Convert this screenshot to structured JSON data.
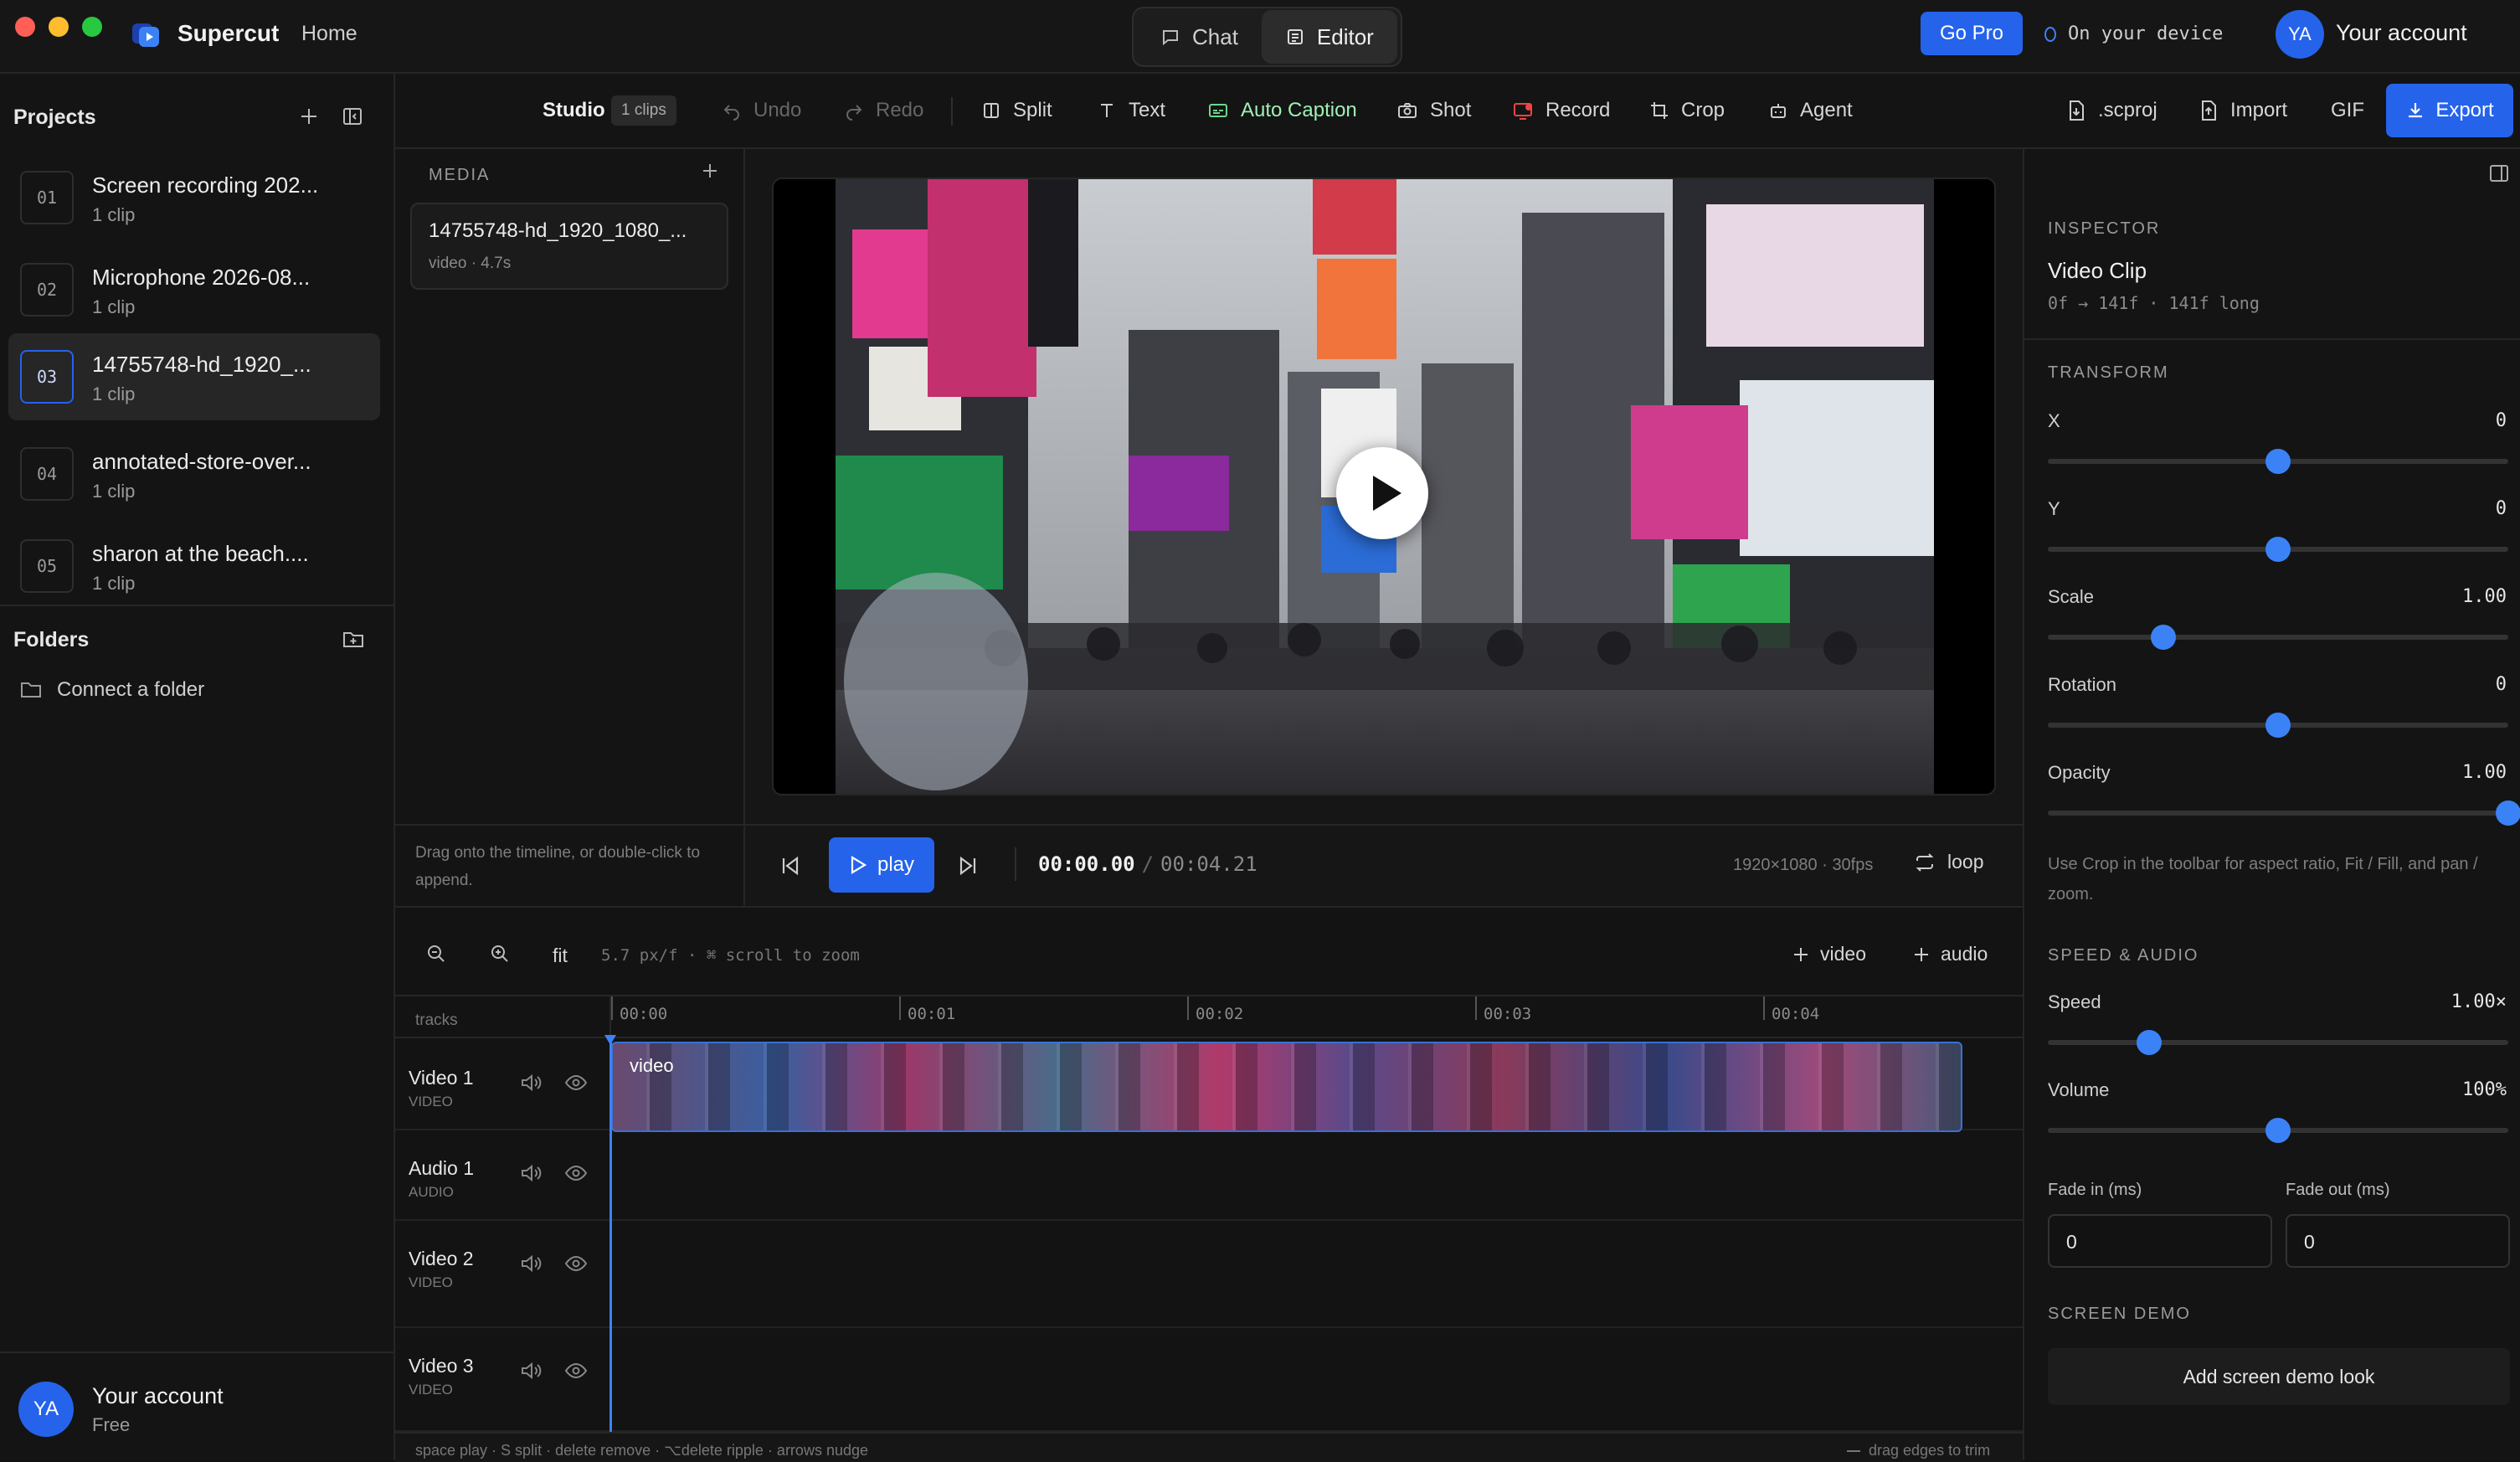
{
  "app": {
    "name": "Supercut",
    "home": "Home"
  },
  "mode_tabs": [
    {
      "label": "Chat",
      "icon": "chat-icon"
    },
    {
      "label": "Editor",
      "icon": "editor-icon",
      "active": true
    }
  ],
  "topbar": {
    "go_pro": "Go Pro",
    "device": "On your device",
    "avatar": "YA",
    "account": "Your account"
  },
  "sidebar": {
    "projects_title": "Projects",
    "projects": [
      {
        "num": "01",
        "title": "Screen recording 202...",
        "sub": "1 clip"
      },
      {
        "num": "02",
        "title": "Microphone 2026-08...",
        "sub": "1 clip"
      },
      {
        "num": "03",
        "title": "14755748-hd_1920_...",
        "sub": "1 clip",
        "active": true
      },
      {
        "num": "04",
        "title": "annotated-store-over...",
        "sub": "1 clip"
      },
      {
        "num": "05",
        "title": "sharon at the beach....",
        "sub": "1 clip"
      }
    ],
    "folders_title": "Folders",
    "connect_folder": "Connect a folder",
    "account": {
      "avatar": "YA",
      "name": "Your account",
      "plan": "Free"
    }
  },
  "toolbar": {
    "studio": "Studio",
    "clips_badge": "1 clips",
    "undo": "Undo",
    "redo": "Redo",
    "split": "Split",
    "text": "Text",
    "auto_caption": "Auto Caption",
    "shot": "Shot",
    "record": "Record",
    "crop": "Crop",
    "agent": "Agent",
    "scproj": ".scproj",
    "import": "Import",
    "gif": "GIF",
    "export": "Export"
  },
  "media": {
    "title": "MEDIA",
    "item": {
      "name": "14755748-hd_1920_1080_...",
      "meta": "video · 4.7s"
    },
    "hint": "Drag onto the timeline, or double-click to append."
  },
  "player": {
    "play": "play",
    "current": "00:00.00",
    "separator": "/",
    "total": "00:04.21",
    "spec": "1920×1080 · 30fps",
    "loop": "loop"
  },
  "inspector": {
    "title": "INSPECTOR",
    "clip_name": "Video Clip",
    "clip_range": "0f → 141f · 141f long",
    "transform_title": "TRANSFORM",
    "transform": [
      {
        "label": "X",
        "value": "0",
        "level": 0.5
      },
      {
        "label": "Y",
        "value": "0",
        "level": 0.5
      },
      {
        "label": "Scale",
        "value": "1.00",
        "level": 0.25
      },
      {
        "label": "Rotation",
        "value": "0",
        "level": 0.5
      },
      {
        "label": "Opacity",
        "value": "1.00",
        "level": 1.0
      }
    ],
    "crop_hint": "Use Crop in the toolbar for aspect ratio, Fit / Fill, and pan / zoom.",
    "speed_title": "SPEED & AUDIO",
    "speed": {
      "label": "Speed",
      "value": "1.00×",
      "level": 0.22
    },
    "volume": {
      "label": "Volume",
      "value": "100%",
      "level": 0.5
    },
    "fade_in": {
      "label": "Fade in (ms)",
      "value": "0"
    },
    "fade_out": {
      "label": "Fade out (ms)",
      "value": "0"
    },
    "screen_demo_title": "SCREEN DEMO",
    "screen_demo_button": "Add screen demo look"
  },
  "timeline": {
    "fit": "fit",
    "zoom_info": "5.7 px/f · ⌘ scroll to zoom",
    "add_video": "video",
    "add_audio": "audio",
    "tracks_label": "tracks",
    "ruler": [
      "00:00",
      "00:01",
      "00:02",
      "00:03",
      "00:04"
    ],
    "tracks": [
      {
        "name": "Video 1",
        "type": "VIDEO"
      },
      {
        "name": "Audio 1",
        "type": "AUDIO"
      },
      {
        "name": "Video 2",
        "type": "VIDEO"
      },
      {
        "name": "Video 3",
        "type": "VIDEO"
      }
    ],
    "clip_label": "video",
    "footer_left": "space play · S split · delete remove · ⌥delete ripple · arrows nudge",
    "footer_right": "drag edges to trim"
  },
  "colors": {
    "accent": "#3b82f6",
    "bg": "#111111",
    "panel": "#141414"
  }
}
